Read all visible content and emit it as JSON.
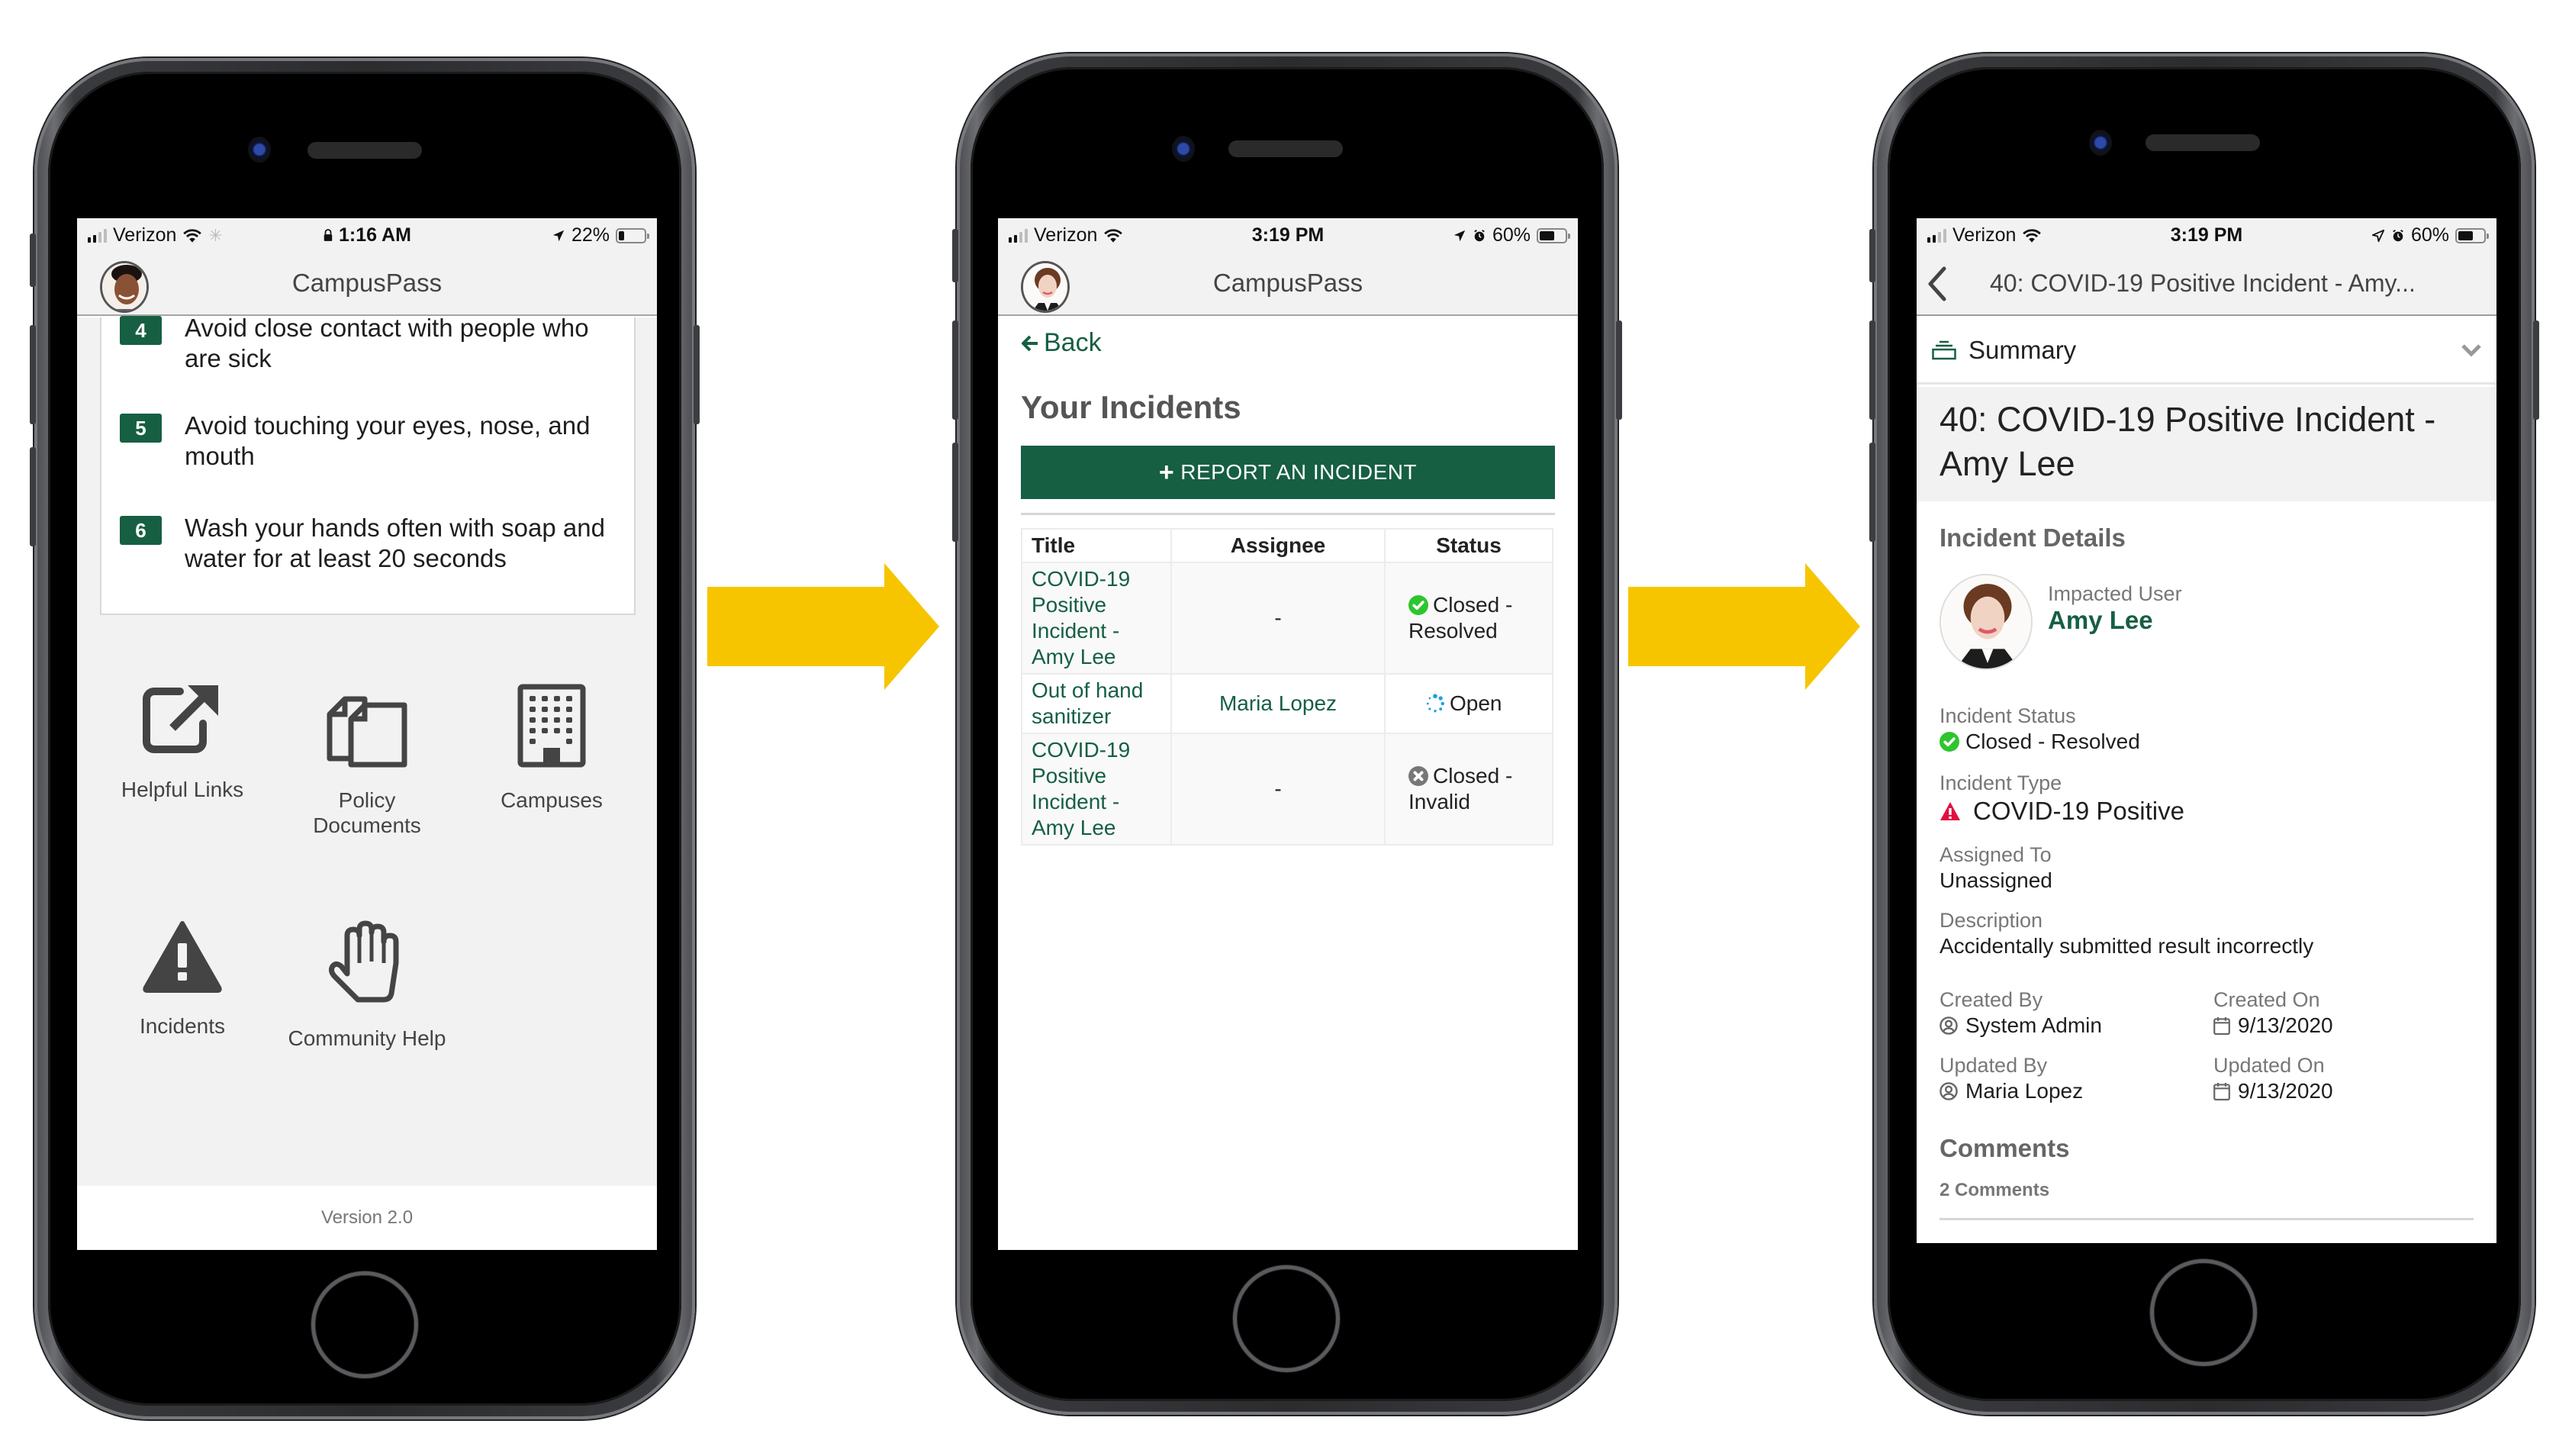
{
  "colors": {
    "brand_green": "#165f43",
    "arrow_yellow": "#f6c500",
    "status_green": "#2ec52e",
    "status_gray": "#777777",
    "open_blue": "#1f9fe0",
    "warning_red": "#e0113f"
  },
  "screens": [
    {
      "status_bar": {
        "carrier": "Verizon",
        "time": "1:16 AM",
        "battery": "22%",
        "battery_level": 0.22,
        "icons": [
          "signal-icon",
          "wifi-icon",
          "activity-spinner-icon",
          "lock-icon",
          "location-icon",
          "battery-icon"
        ]
      },
      "app_title": "CampusPass",
      "tips": [
        {
          "number": "4",
          "text": "Avoid close contact with people who are sick"
        },
        {
          "number": "5",
          "text": "Avoid touching your eyes, nose, and mouth"
        },
        {
          "number": "6",
          "text": "Wash your hands often with soap and water for at least 20 seconds"
        }
      ],
      "tiles": [
        {
          "label": "Helpful Links",
          "icon": "external-link-icon"
        },
        {
          "label": "Policy Documents",
          "icon": "documents-icon"
        },
        {
          "label": "Campuses",
          "icon": "building-icon"
        },
        {
          "label": "Incidents",
          "icon": "warning-icon"
        },
        {
          "label": "Community Help",
          "icon": "hand-icon"
        }
      ],
      "version": "Version 2.0"
    },
    {
      "status_bar": {
        "carrier": "Verizon",
        "time": "3:19 PM",
        "battery": "60%",
        "battery_level": 0.6,
        "icons": [
          "signal-icon",
          "wifi-icon",
          "location-icon",
          "alarm-icon",
          "battery-icon"
        ]
      },
      "app_title": "CampusPass",
      "back_label": "Back",
      "page_title": "Your Incidents",
      "report_button": "REPORT AN INCIDENT",
      "table": {
        "columns": [
          "Title",
          "Assignee",
          "Status"
        ],
        "rows": [
          {
            "title": "COVID-19 Positive Incident - Amy Lee",
            "assignee": "-",
            "status": "Closed - Resolved",
            "status_icon": "check-circle-icon"
          },
          {
            "title": "Out of hand sanitizer",
            "assignee": "Maria Lopez",
            "status": "Open",
            "status_icon": "spinner-icon"
          },
          {
            "title": "COVID-19 Positive Incident - Amy Lee",
            "assignee": "-",
            "status": "Closed - Invalid",
            "status_icon": "x-circle-icon"
          }
        ]
      }
    },
    {
      "status_bar": {
        "carrier": "Verizon",
        "time": "3:19 PM",
        "battery": "60%",
        "battery_level": 0.6,
        "icons": [
          "signal-icon",
          "wifi-icon",
          "location-icon",
          "alarm-icon",
          "battery-icon"
        ]
      },
      "nav_title": "40: COVID-19 Positive Incident - Amy...",
      "summary_label": "Summary",
      "detail_title": "40: COVID-19 Positive Incident - Amy Lee",
      "section_incident_details": "Incident Details",
      "impacted_user": {
        "label": "Impacted User",
        "name": "Amy Lee"
      },
      "incident_status": {
        "label": "Incident Status",
        "value": "Closed - Resolved"
      },
      "incident_type": {
        "label": "Incident Type",
        "value": "COVID-19 Positive"
      },
      "assigned_to": {
        "label": "Assigned To",
        "value": "Unassigned"
      },
      "description": {
        "label": "Description",
        "value": "Accidentally submitted result incorrectly"
      },
      "created_by": {
        "label": "Created By",
        "value": "System Admin"
      },
      "created_on": {
        "label": "Created On",
        "value": "9/13/2020"
      },
      "updated_by": {
        "label": "Updated By",
        "value": "Maria Lopez"
      },
      "updated_on": {
        "label": "Updated On",
        "value": "9/13/2020"
      },
      "section_comments": "Comments",
      "comments_count": "2 Comments"
    }
  ]
}
